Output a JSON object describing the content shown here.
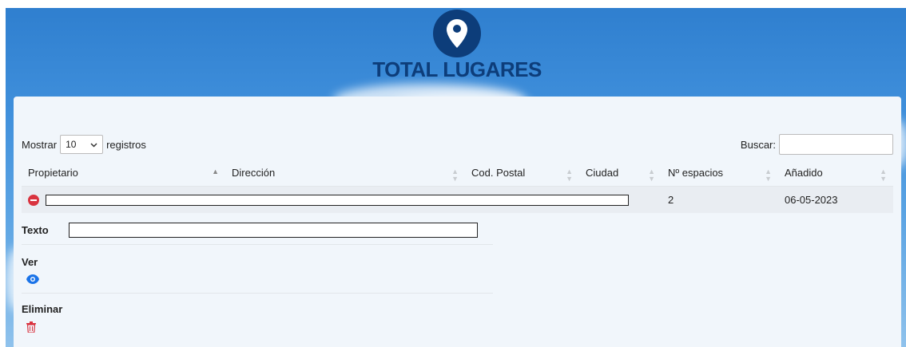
{
  "header": {
    "title": "TOTAL LUGARES",
    "logo_icon": "map-pin-icon"
  },
  "table_controls": {
    "length_prefix": "Mostrar",
    "length_value": "10",
    "length_suffix": "registros",
    "search_label": "Buscar:",
    "search_value": ""
  },
  "columns": [
    "Propietario",
    "Dirección",
    "Cod. Postal",
    "Ciudad",
    "Nº espacios",
    "Añadido"
  ],
  "rows": [
    {
      "nspacios": "2",
      "added": "06-05-2023"
    }
  ],
  "details": {
    "text_label": "Texto",
    "view_label": "Ver",
    "delete_label": "Eliminar"
  },
  "colors": {
    "brand": "#0d3d7a",
    "delete": "#d9333f",
    "view": "#1a73e8"
  }
}
